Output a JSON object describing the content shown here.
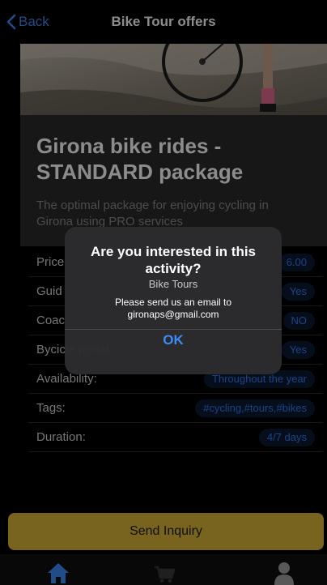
{
  "nav": {
    "back_label": "Back",
    "title": "Bike Tour offers"
  },
  "tour": {
    "title": "Girona bike rides - STANDARD package",
    "description": "The optimal package for enjoying cycling in Girona using PRO services"
  },
  "details": [
    {
      "label": "Price",
      "value": "6.00"
    },
    {
      "label": "Guid",
      "value": "Yes"
    },
    {
      "label": "Coac",
      "value": "NO"
    },
    {
      "label": "Bycicle rental:",
      "value": "Yes"
    },
    {
      "label": "Availability:",
      "value": "Throughout the year"
    },
    {
      "label": "Tags:",
      "value": "#cycling,#tours,#bikes"
    },
    {
      "label": "Duration:",
      "value": "4/7 days"
    }
  ],
  "send_inquiry_label": "Send Inquiry",
  "tabbar": {
    "items": [
      "home-icon",
      "cart-icon",
      "profile-icon"
    ]
  },
  "alert": {
    "title": "Are you interested in this activity?",
    "subtitle": "Bike Tours",
    "message_line1": "Please send us an email to",
    "message_line2": "gironaps@gmail.com",
    "ok_label": "OK"
  },
  "colors": {
    "accent": "#3b8cf6",
    "button": "#dcb73a",
    "badge_bg": "#0c1a33",
    "badge_text": "#2f7df5"
  }
}
